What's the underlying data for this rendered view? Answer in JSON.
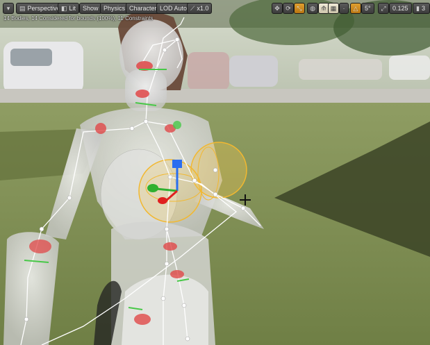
{
  "toolbar": {
    "menu_icon": "chevron-down-icon",
    "perspective_label": "Perspective",
    "lit_label": "Lit",
    "show_label": "Show",
    "physics_label": "Physics",
    "character_label": "Character",
    "lod_label": "LOD Auto",
    "speed_label": "x1.0",
    "snap_value": "0.125",
    "angle_value": "5°",
    "camera_value": "3"
  },
  "overlay": {
    "stats_text": "14 Bodies, 14 Considered for bounds (100%), 11 Constraints"
  },
  "colors": {
    "accent": "#e0a030",
    "toolbar_bg": "#3c3c3c",
    "constraint_ring": "#f2b830",
    "joint_red": "#e04848",
    "joint_green": "#48c848"
  }
}
